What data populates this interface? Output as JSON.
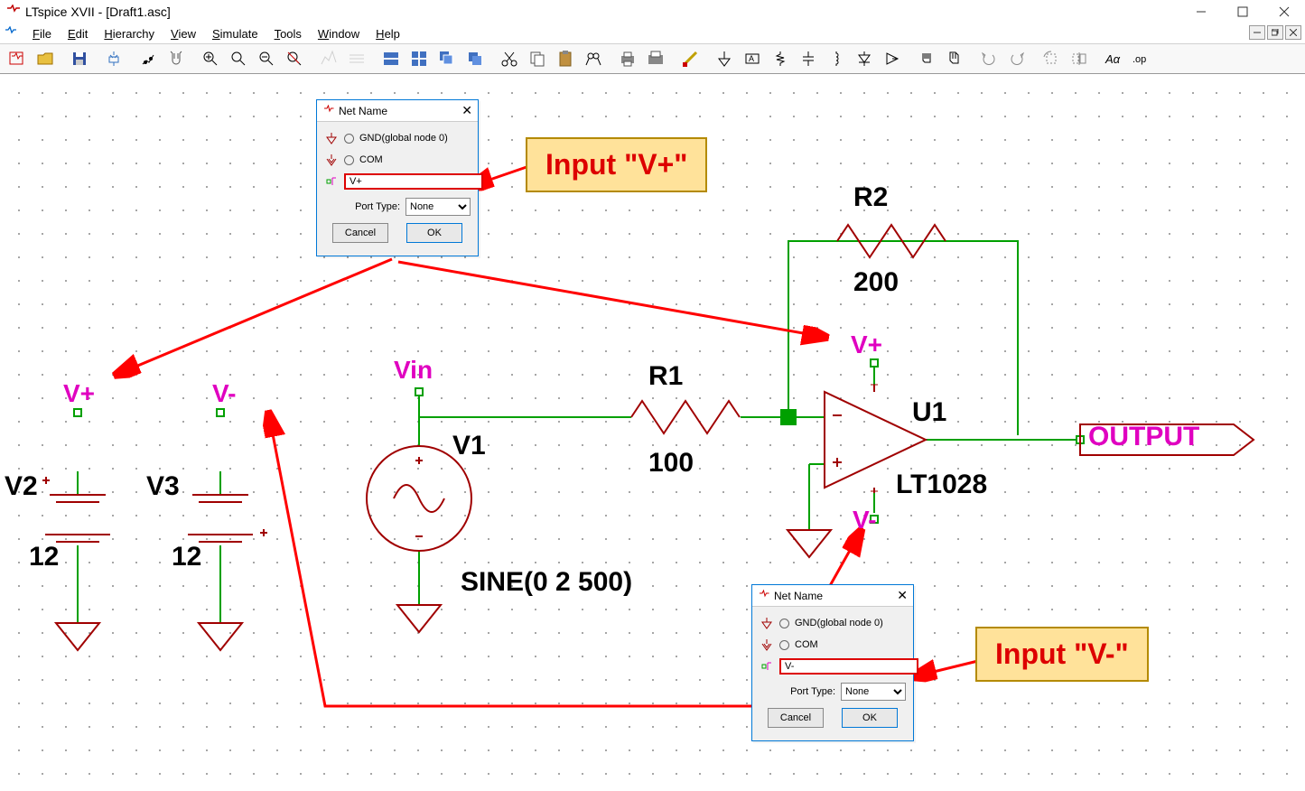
{
  "window": {
    "title": "LTspice XVII - [Draft1.asc]"
  },
  "menus": {
    "file": "File",
    "edit": "Edit",
    "hierarchy": "Hierarchy",
    "view": "View",
    "simulate": "Simulate",
    "tools": "Tools",
    "window": "Window",
    "help": "Help"
  },
  "dialog1": {
    "title": "Net Name",
    "opt_gnd": "GND(global node 0)",
    "opt_com": "COM",
    "value": "V+",
    "port_label": "Port Type:",
    "port_value": "None",
    "cancel": "Cancel",
    "ok": "OK"
  },
  "dialog2": {
    "title": "Net Name",
    "opt_gnd": "GND(global node 0)",
    "opt_com": "COM",
    "value": "V-",
    "port_label": "Port Type:",
    "port_value": "None",
    "cancel": "Cancel",
    "ok": "OK"
  },
  "nets": {
    "vplus_left": "V+",
    "vminus_left": "V-",
    "vin": "Vin",
    "vplus_right": "V+",
    "vminus_right": "V-",
    "output": "OUTPUT"
  },
  "parts": {
    "V1": {
      "ref": "V1",
      "func": "SINE(0 2 500)"
    },
    "V2": {
      "ref": "V2",
      "val": "12"
    },
    "V3": {
      "ref": "V3",
      "val": "12"
    },
    "R1": {
      "ref": "R1",
      "val": "100"
    },
    "R2": {
      "ref": "R2",
      "val": "200"
    },
    "U1": {
      "ref": "U1",
      "model": "LT1028"
    }
  },
  "callouts": {
    "c1": "Input \"V+\"",
    "c2": "Input \"V-\""
  }
}
